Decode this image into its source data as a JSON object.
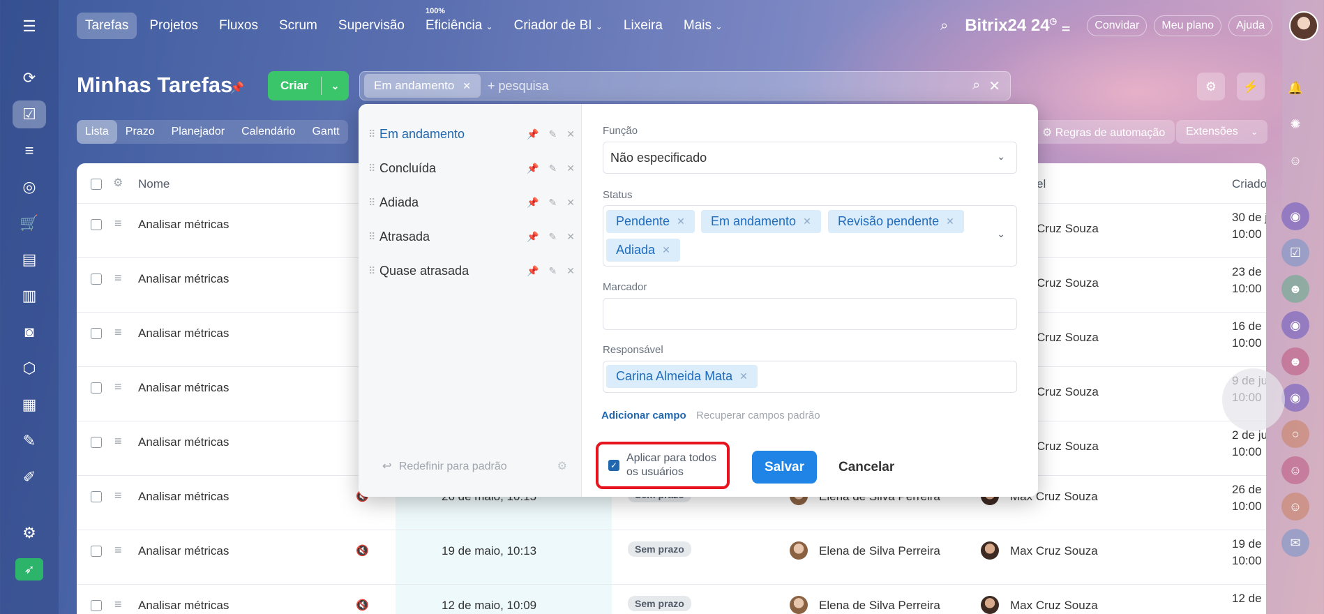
{
  "nav": {
    "items": [
      "Tarefas",
      "Projetos",
      "Fluxos",
      "Scrum",
      "Supervisão",
      "Eficiência",
      "Criador de BI",
      "Lixeira",
      "Mais"
    ],
    "efficiency_badge": "100%",
    "brand": "Bitrix24",
    "brand_num": "24",
    "invite": "Convidar",
    "plan": "Meu plano",
    "help": "Ajuda"
  },
  "header": {
    "title": "Minhas Tarefas",
    "create_label": "Criar",
    "search_chip": "Em andamento",
    "search_placeholder": "+ pesquisa"
  },
  "view_tabs": [
    "Lista",
    "Prazo",
    "Planejador",
    "Calendário",
    "Gantt"
  ],
  "toolbar": {
    "automation_rules": "Regras de automação",
    "extensions": "Extensões"
  },
  "table": {
    "col_name": "Nome",
    "col_resp_partial": "el",
    "col_created_partial": "Criado",
    "rows": [
      {
        "name": "Analisar métricas",
        "resp": "Cruz Souza",
        "created1": "30 de j",
        "created2": "10:00"
      },
      {
        "name": "Analisar métricas",
        "resp": "Cruz Souza",
        "created1": "23 de",
        "created2": "10:00"
      },
      {
        "name": "Analisar métricas",
        "resp": "Cruz Souza",
        "created1": "16 de",
        "created2": "10:00"
      },
      {
        "name": "Analisar métricas",
        "resp": "Cruz Souza",
        "created1": "9 de ju",
        "created2": "10:00"
      },
      {
        "name": "Analisar métricas",
        "resp": "Cruz Souza",
        "created1": "2 de ju",
        "created2": "10:00"
      },
      {
        "name": "Analisar métricas",
        "deadline": "26 de maio, 10:15",
        "status": "Sem prazo",
        "creator": "Elena de Silva Perreira",
        "resp": "Max Cruz Souza",
        "created1": "26 de",
        "created2": "10:00"
      },
      {
        "name": "Analisar métricas",
        "deadline": "19 de maio, 10:13",
        "status": "Sem prazo",
        "creator": "Elena de Silva Perreira",
        "resp": "Max Cruz Souza",
        "created1": "19 de",
        "created2": "10:00"
      },
      {
        "name": "Analisar métricas",
        "deadline": "12 de maio, 10:09",
        "status": "Sem prazo",
        "creator": "Elena de Silva Perreira",
        "resp": "Max Cruz Souza",
        "created1": "12 de",
        "created2": ""
      }
    ]
  },
  "filter_panel": {
    "presets": [
      "Em andamento",
      "Concluída",
      "Adiada",
      "Atrasada",
      "Quase atrasada"
    ],
    "reset_label": "Redefinir para padrão",
    "role_label": "Função",
    "role_value": "Não especificado",
    "status_label": "Status",
    "status_tags": [
      "Pendente",
      "Em andamento",
      "Revisão pendente",
      "Adiada"
    ],
    "tag_label": "Marcador",
    "responsible_label": "Responsável",
    "responsible_tag": "Carina Almeida Mata",
    "add_field": "Adicionar campo",
    "restore_fields": "Recuperar campos padrão",
    "apply_all_line1": "Aplicar para todos",
    "apply_all_line2": "os usuários",
    "save": "Salvar",
    "cancel": "Cancelar"
  }
}
